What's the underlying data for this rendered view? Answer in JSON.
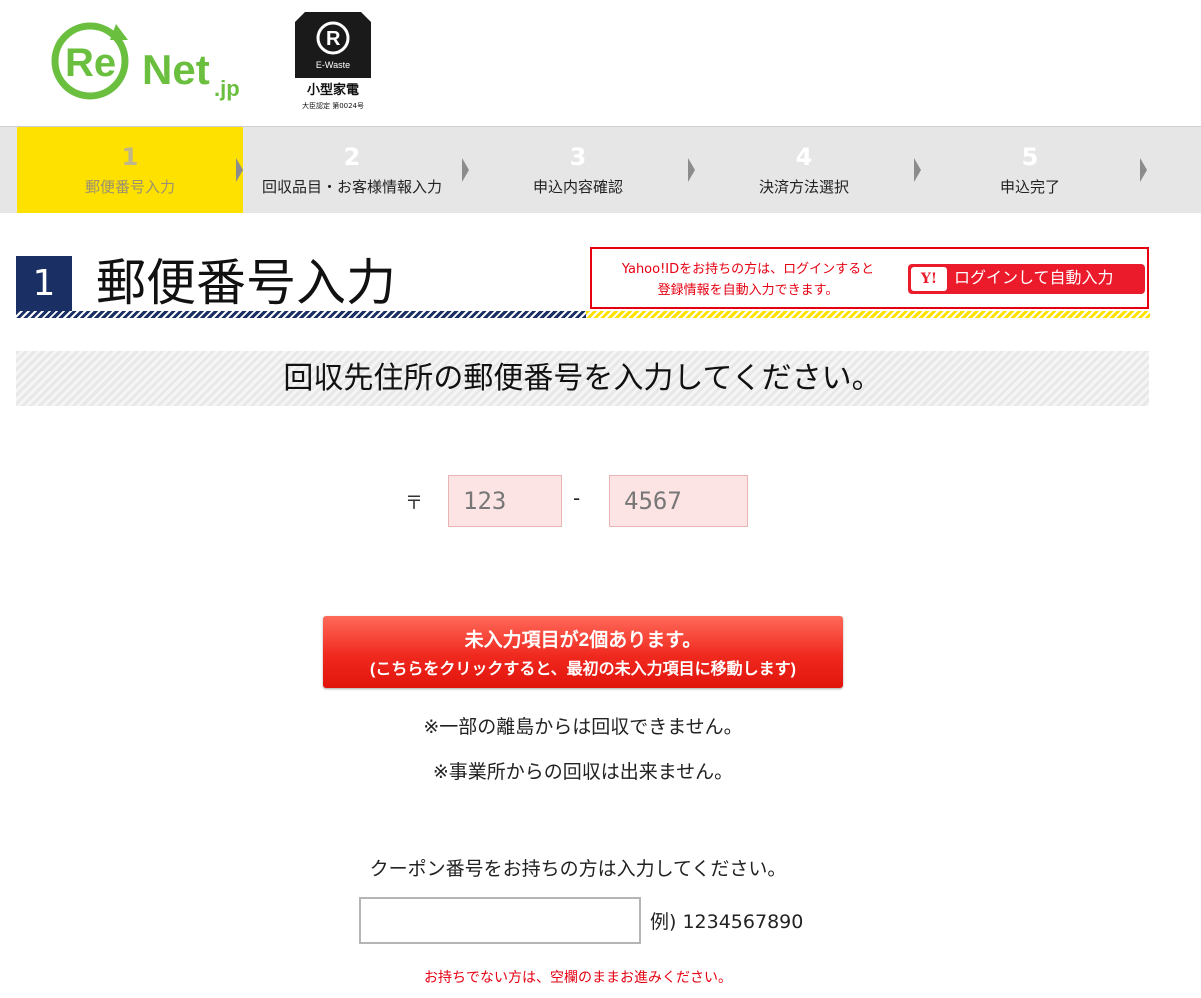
{
  "header": {
    "renet_logo_text": "Re Net.jp",
    "ewaste_logo_text": "E-Waste",
    "ewaste_logo_title": "小型家電",
    "ewaste_logo_cert": "大臣認定 第0024号"
  },
  "steps": [
    {
      "num": "1",
      "label": "郵便番号入力",
      "active": true
    },
    {
      "num": "2",
      "label": "回収品目・お客様情報入力",
      "active": false
    },
    {
      "num": "3",
      "label": "申込内容確認",
      "active": false
    },
    {
      "num": "4",
      "label": "決済方法選択",
      "active": false
    },
    {
      "num": "5",
      "label": "申込完了",
      "active": false
    }
  ],
  "section": {
    "number": "1",
    "title": "郵便番号入力"
  },
  "yahoo": {
    "note_line1": "Yahoo!IDをお持ちの方は、ログインすると",
    "note_line2": "登録情報を自動入力できます。",
    "logo": "Y!",
    "button_label": "ログインして自動入力"
  },
  "instruction": "回収先住所の郵便番号を入力してください。",
  "postal": {
    "mark": "〒",
    "first_placeholder": "123",
    "dash": "-",
    "second_placeholder": "4567"
  },
  "alert": {
    "line1": "未入力項目が2個あります。",
    "line2": "(こちらをクリックすると、最初の未入力項目に移動します)"
  },
  "notes": [
    "※一部の離島からは回収できません。",
    "※事業所からの回収は出来ません。"
  ],
  "coupon": {
    "label": "クーポン番号をお持ちの方は入力してください。",
    "value": "",
    "example": "例) 1234567890",
    "note": "お持ちでない方は、空欄のままお進みください。"
  },
  "colors": {
    "accent_yellow": "#ffe100",
    "navy": "#1a2f63",
    "red": "#e60012",
    "renet_green": "#6bbf3f"
  }
}
